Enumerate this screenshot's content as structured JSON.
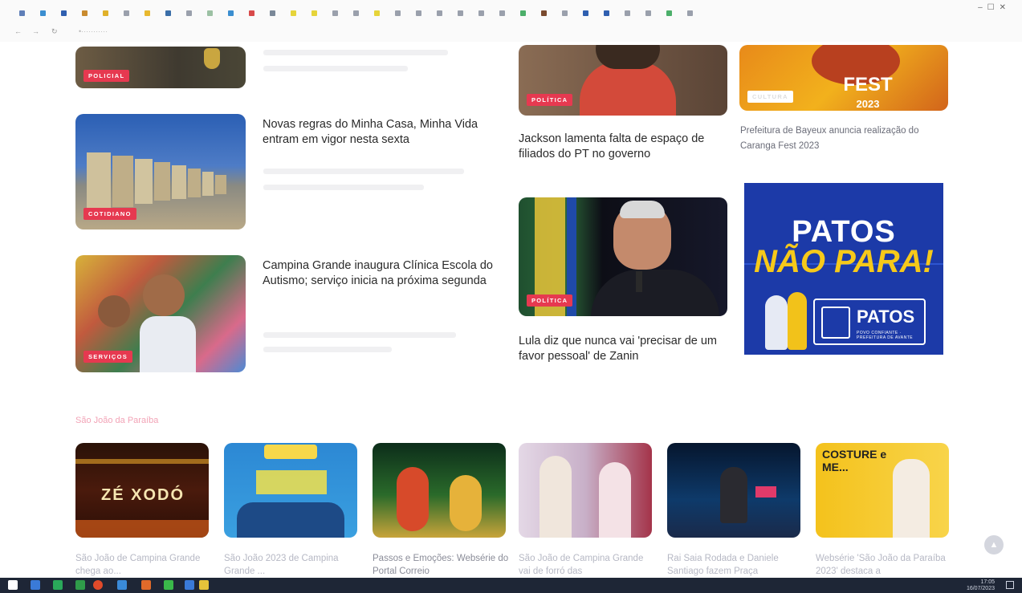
{
  "browser": {
    "tabs": [
      {
        "icon": "page-icon",
        "color": "#5f7fb8"
      },
      {
        "icon": "page-icon",
        "color": "#3b8ed0"
      },
      {
        "icon": "page-icon",
        "color": "#2f5fb0"
      },
      {
        "icon": "page-icon",
        "color": "#c98b2e"
      },
      {
        "icon": "page-icon",
        "color": "#e0b12a"
      },
      {
        "icon": "page-icon",
        "color": "#9aa0ac"
      },
      {
        "icon": "page-icon",
        "color": "#e8b82e"
      },
      {
        "icon": "page-icon",
        "color": "#3a6ea8"
      },
      {
        "icon": "page-icon",
        "color": "#9aa0ac"
      },
      {
        "icon": "page-icon",
        "color": "#9cc1a4"
      },
      {
        "icon": "page-icon",
        "color": "#3b8ed0"
      },
      {
        "icon": "page-icon",
        "color": "#d84a4a"
      },
      {
        "icon": "page-icon",
        "color": "#7a8898"
      },
      {
        "icon": "page-icon",
        "color": "#e6d43a"
      },
      {
        "icon": "page-icon",
        "color": "#e6d43a"
      },
      {
        "icon": "page-icon",
        "color": "#9aa0ac"
      },
      {
        "icon": "page-icon",
        "color": "#9aa0ac"
      },
      {
        "icon": "page-icon",
        "color": "#e6d43a"
      },
      {
        "icon": "page-icon",
        "color": "#9aa0ac"
      },
      {
        "icon": "page-icon",
        "color": "#9aa0ac"
      },
      {
        "icon": "page-icon",
        "color": "#9aa0ac"
      },
      {
        "icon": "page-icon",
        "color": "#9aa0ac"
      },
      {
        "icon": "page-icon",
        "color": "#9aa0ac"
      },
      {
        "icon": "page-icon",
        "color": "#9aa0ac"
      },
      {
        "icon": "page-icon",
        "color": "#4caf6a"
      },
      {
        "icon": "page-icon",
        "color": "#7a4a2e"
      },
      {
        "icon": "page-icon",
        "color": "#9aa0ac"
      },
      {
        "icon": "page-icon",
        "color": "#2f5fb0"
      },
      {
        "icon": "page-icon",
        "color": "#2f5fb0"
      },
      {
        "icon": "page-icon",
        "color": "#9aa0ac"
      },
      {
        "icon": "page-icon",
        "color": "#9aa0ac"
      },
      {
        "icon": "page-icon",
        "color": "#4caf6a"
      },
      {
        "icon": "page-icon",
        "color": "#9aa0ac"
      }
    ]
  },
  "articles": [
    {
      "badge": "POLICIAL",
      "headline": ""
    },
    {
      "badge": "COTIDIANO",
      "headline": "Novas regras do Minha Casa, Minha Vida entram em vigor nesta sexta"
    },
    {
      "badge": "SERVIÇOS",
      "headline": "Campina Grande inaugura Clínica Escola do Autismo; serviço inicia na próxima segunda"
    },
    {
      "badge": "POLÍTICA",
      "headline": "Jackson lamenta falta de espaço de filiados do PT no governo"
    },
    {
      "badge": "POLÍTICA",
      "headline": "Lula diz que nunca vai 'precisar de um favor pessoal' de Zanin"
    },
    {
      "badge": "CULTURA",
      "headline": "Prefeitura de Bayeux anuncia realização do Caranga Fest 2023"
    }
  ],
  "fest_img_text": {
    "fest": "FEST",
    "year": "2023"
  },
  "ad": {
    "line1": "PATOS",
    "line2": "NÃO PARA!",
    "logo": "PATOS",
    "logo_sub": "POVO CONFIANTE · PREFEITURA DE AVANTE"
  },
  "section": {
    "title": "São João da Paraíba"
  },
  "sj_items": [
    {
      "caption": "São João de Campina Grande chega ao...",
      "img_text": "ZÉ XODÓ"
    },
    {
      "caption": "São João 2023 de Campina Grande ...",
      "img_text": ""
    },
    {
      "caption": "Passos e Emoções: Websérie do Portal Correio",
      "img_text": ""
    },
    {
      "caption": "São João de Campina Grande vai de forró das",
      "img_text": ""
    },
    {
      "caption": "Rai Saia Rodada e Daniele Santiago fazem Praça",
      "img_text": ""
    },
    {
      "caption": "Websérie 'São João da Paraíba 2023' destaca a",
      "img_text": "COSTURE e ME..."
    }
  ],
  "taskbar": {
    "time": "17:05",
    "date": "16/07/2023"
  },
  "colors": {
    "badge": "#e63950",
    "ad_bg": "#1c3aa8",
    "ad_yellow": "#f6c91a",
    "section_title": "#f2a3b6"
  }
}
